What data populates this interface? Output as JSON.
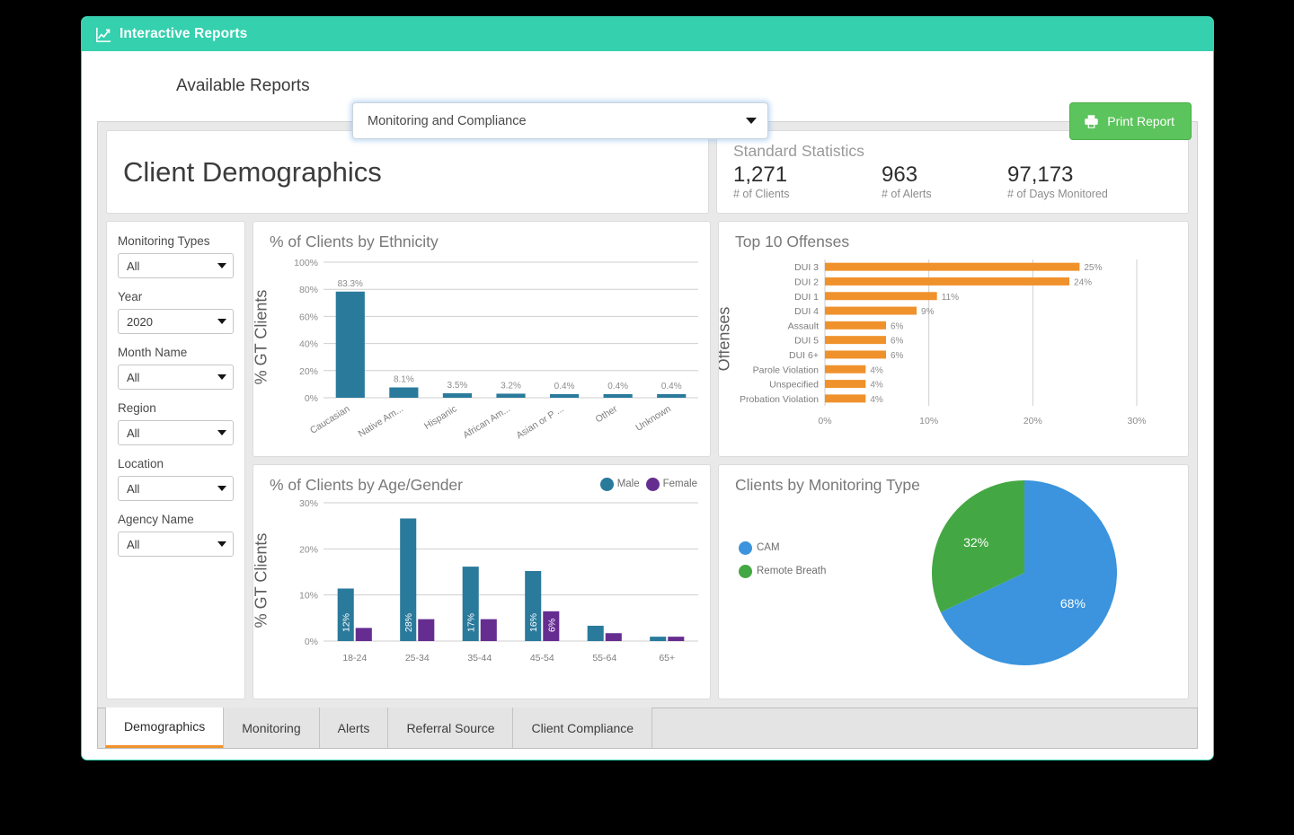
{
  "titlebar": {
    "icon": "line-chart-icon",
    "title": "Interactive Reports"
  },
  "toolbar": {
    "available_reports_label": "Available Reports",
    "report_select_value": "Monitoring and Compliance",
    "print_label": "Print Report",
    "print_icon": "printer-icon"
  },
  "page_title": "Client Demographics",
  "stats": {
    "heading": "Standard Statistics",
    "items": [
      {
        "value": "1,271",
        "label": "# of Clients"
      },
      {
        "value": "963",
        "label": "# of Alerts"
      },
      {
        "value": "97,173",
        "label": "# of Days Monitored"
      }
    ]
  },
  "filters": [
    {
      "label": "Monitoring Types",
      "value": "All"
    },
    {
      "label": "Year",
      "value": "2020"
    },
    {
      "label": "Month Name",
      "value": "All"
    },
    {
      "label": "Region",
      "value": "All"
    },
    {
      "label": "Location",
      "value": "All"
    },
    {
      "label": "Agency Name",
      "value": "All"
    }
  ],
  "tabs": [
    {
      "label": "Demographics",
      "active": true
    },
    {
      "label": "Monitoring",
      "active": false
    },
    {
      "label": "Alerts",
      "active": false
    },
    {
      "label": "Referral Source",
      "active": false
    },
    {
      "label": "Client Compliance",
      "active": false
    }
  ],
  "colors": {
    "header_teal": "#35d0ae",
    "print_green": "#5cc45c",
    "bar_teal": "#2a7a9c",
    "bar_purple": "#662d91",
    "bar_orange": "#f0922c",
    "pie_blue": "#3b94dd",
    "pie_green": "#43a843",
    "active_tab_underline": "#f0922c"
  },
  "chart_data": [
    {
      "type": "bar",
      "id": "ethnicity",
      "title": "% of Clients by Ethnicity",
      "xlabel": "",
      "ylabel": "% GT Clients",
      "ylim": [
        0,
        100
      ],
      "yticks": [
        "0%",
        "20%",
        "40%",
        "60%",
        "80%",
        "100%"
      ],
      "grid": true,
      "categories": [
        "Caucasian",
        "Native Am...",
        "Hispanic",
        "African Am...",
        "Asian or P ...",
        "Other",
        "Unknown"
      ],
      "values": [
        83.3,
        8.1,
        3.5,
        3.2,
        0.4,
        0.4,
        0.4
      ],
      "data_labels": [
        "83.3%",
        "8.1%",
        "3.5%",
        "3.2%",
        "0.4%",
        "0.4%",
        "0.4%"
      ],
      "bar_color": "#2a7a9c"
    },
    {
      "type": "bar",
      "id": "offenses",
      "orientation": "horizontal",
      "title": "Top 10 Offenses",
      "xlabel": "",
      "ylabel": "Offenses",
      "xlim": [
        0,
        30
      ],
      "xticks": [
        "0%",
        "10%",
        "20%",
        "30%"
      ],
      "grid": true,
      "categories": [
        "DUI 3",
        "DUI 2",
        "DUI 1",
        "DUI 4",
        "Assault",
        "DUI 5",
        "DUI 6+",
        "Parole Violation",
        "Unspecified",
        "Probation Violation"
      ],
      "values": [
        25,
        24,
        11,
        9,
        6,
        6,
        6,
        4,
        4,
        4
      ],
      "data_labels": [
        "25%",
        "24%",
        "11%",
        "9%",
        "6%",
        "6%",
        "6%",
        "4%",
        "4%",
        "4%"
      ],
      "bar_color": "#f0922c"
    },
    {
      "type": "bar",
      "id": "age_gender",
      "title": "% of Clients by Age/Gender",
      "xlabel": "",
      "ylabel": "% GT Clients",
      "ylim": [
        0,
        30
      ],
      "yticks": [
        "0%",
        "10%",
        "20%",
        "30%"
      ],
      "grid": true,
      "legend": [
        "Male",
        "Female"
      ],
      "legend_position": "top-right",
      "categories": [
        "18-24",
        "25-34",
        "35-44",
        "45-54",
        "55-64",
        "65+"
      ],
      "series": [
        {
          "name": "Male",
          "color": "#2a7a9c",
          "values": [
            12,
            28,
            17,
            16,
            3.5,
            1
          ],
          "data_labels": [
            "12%",
            "28%",
            "17%",
            "16%",
            "",
            ""
          ]
        },
        {
          "name": "Female",
          "color": "#662d91",
          "values": [
            3,
            5,
            5,
            6.8,
            1.8,
            1
          ],
          "data_labels": [
            "",
            "",
            "",
            "6%",
            "",
            ""
          ]
        }
      ]
    },
    {
      "type": "pie",
      "id": "monitoring_type",
      "title": "Clients by Monitoring Type",
      "labels": [
        "CAM",
        "Remote Breath"
      ],
      "values": [
        68,
        32
      ],
      "data_labels": [
        "68%",
        "32%"
      ],
      "colors": [
        "#3b94dd",
        "#43a843"
      ],
      "legend_position": "left"
    }
  ]
}
